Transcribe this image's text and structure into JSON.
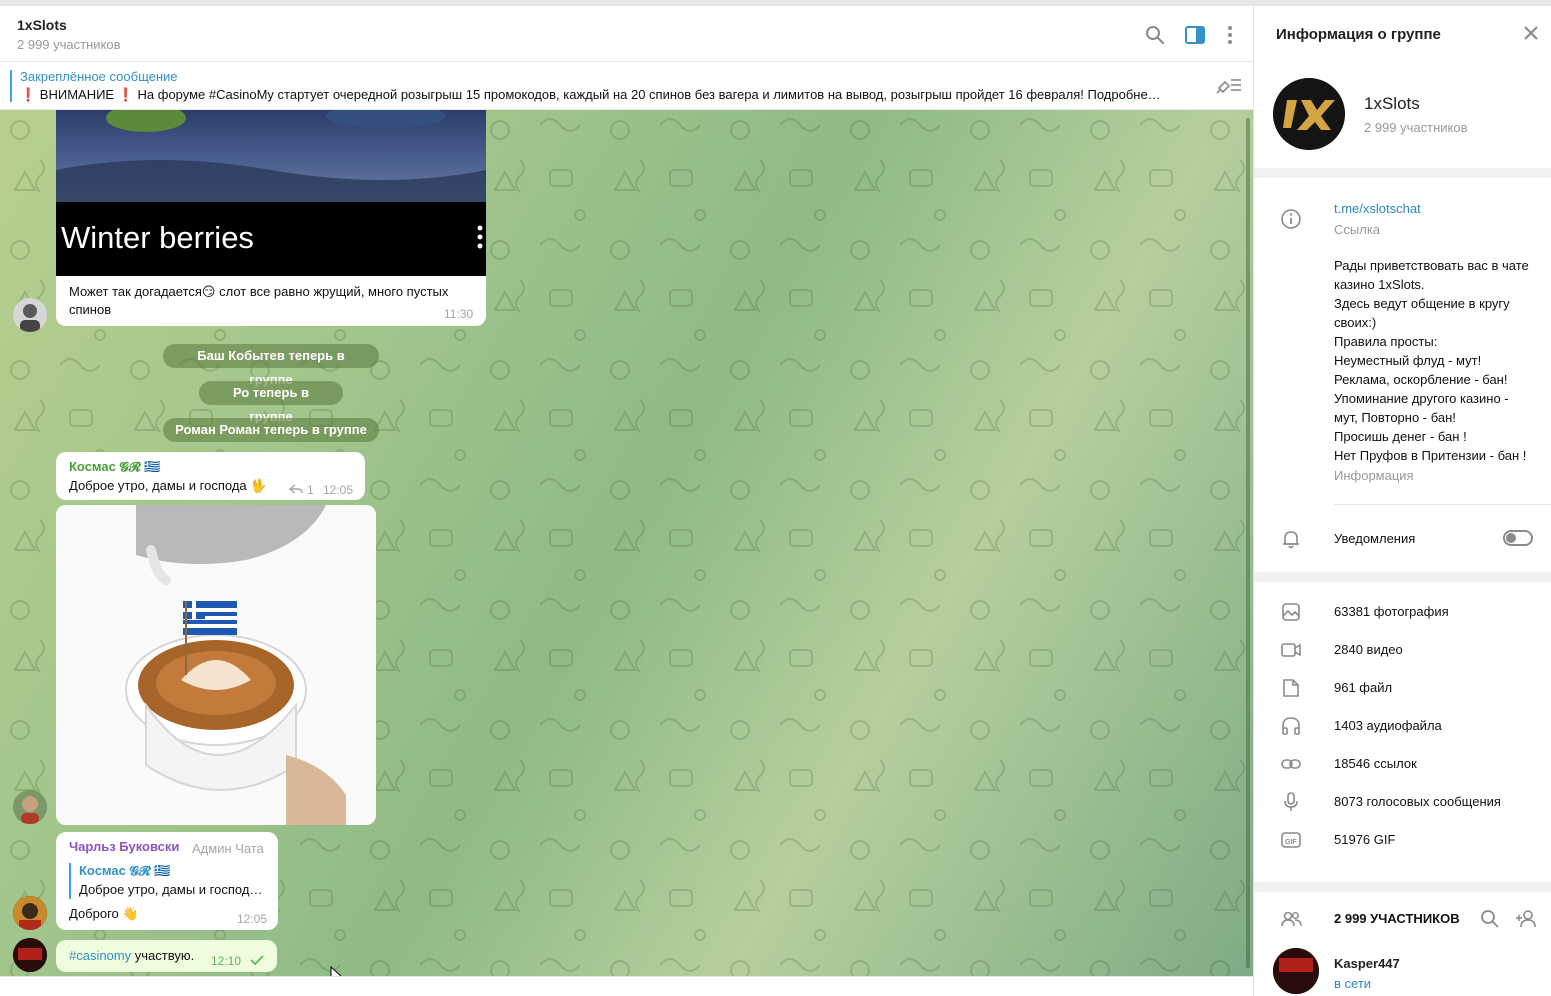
{
  "chat": {
    "title": "1xSlots",
    "members": "2 999 участников"
  },
  "pinned": {
    "title": "Закреплённое сообщение",
    "text": "❗ ВНИМАНИЕ ❗ На форуме #CasinoMy стартует очередной розыгрыш 15 промокодов, каждый на 20 спинов без вагера и лимитов на вывод, розыгрыш пройдет 16 февраля!  Подробне…"
  },
  "messages": {
    "m1": {
      "preview_title": "Winter berries",
      "text": "Может так догадается😏 слот все равно жрущий, много пустых спинов",
      "time": "11:30"
    },
    "service1": "Баш Кобытев теперь в группе",
    "service2": "Ро теперь в группе",
    "service3": "Роман Роман теперь в группе",
    "m2": {
      "sender": "Космас 𝓖𝓡 🇬🇷",
      "text": "Доброе утро, дамы и господа 🖖",
      "replies": "1",
      "time": "12:05"
    },
    "m3": {
      "sender": "Чарльз Буковски",
      "role": "Админ Чата",
      "reply_sender": "Космас 𝓖𝓡 🇬🇷",
      "reply_text": "Доброе утро, дамы и господ…",
      "text": "Доброго 👋",
      "time": "12:05"
    },
    "m4": {
      "hashtag": "#casinomy",
      "text": " участвую.",
      "time": "12:10"
    }
  },
  "info": {
    "title": "Информация о группе",
    "group_name": "1xSlots",
    "group_members": "2 999 участников",
    "link": "t.me/xslotschat",
    "link_caption": "Ссылка",
    "description": [
      "Рады приветствовать вас в чате казино 1xSlots.",
      "Здесь ведут общение в кругу своих:)",
      "Правила просты:",
      "Неуместный флуд - мут!",
      "Реклама, оскорбление - бан!",
      "Упоминание другого казино - мут, Повторно - бан!",
      "Просишь денег - бан !",
      "Нет Пруфов в Притензии - бан !"
    ],
    "description_caption": "Информация",
    "notifications_label": "Уведомления",
    "media": {
      "photos": "63381 фотография",
      "videos": "2840 видео",
      "files": "961 файл",
      "audio": "1403 аудиофайла",
      "links": "18546 ссылок",
      "voice": "8073 голосовых сообщения",
      "gif": "51976 GIF"
    },
    "members_header": "2 999 УЧАСТНИКОВ",
    "member1": {
      "name": "Kasper447",
      "status": "в сети"
    }
  },
  "colors": {
    "accent": "#3390c9",
    "sender1": "#4a9e3a",
    "sender2": "#8a56c2",
    "online": "#2e87c7"
  }
}
